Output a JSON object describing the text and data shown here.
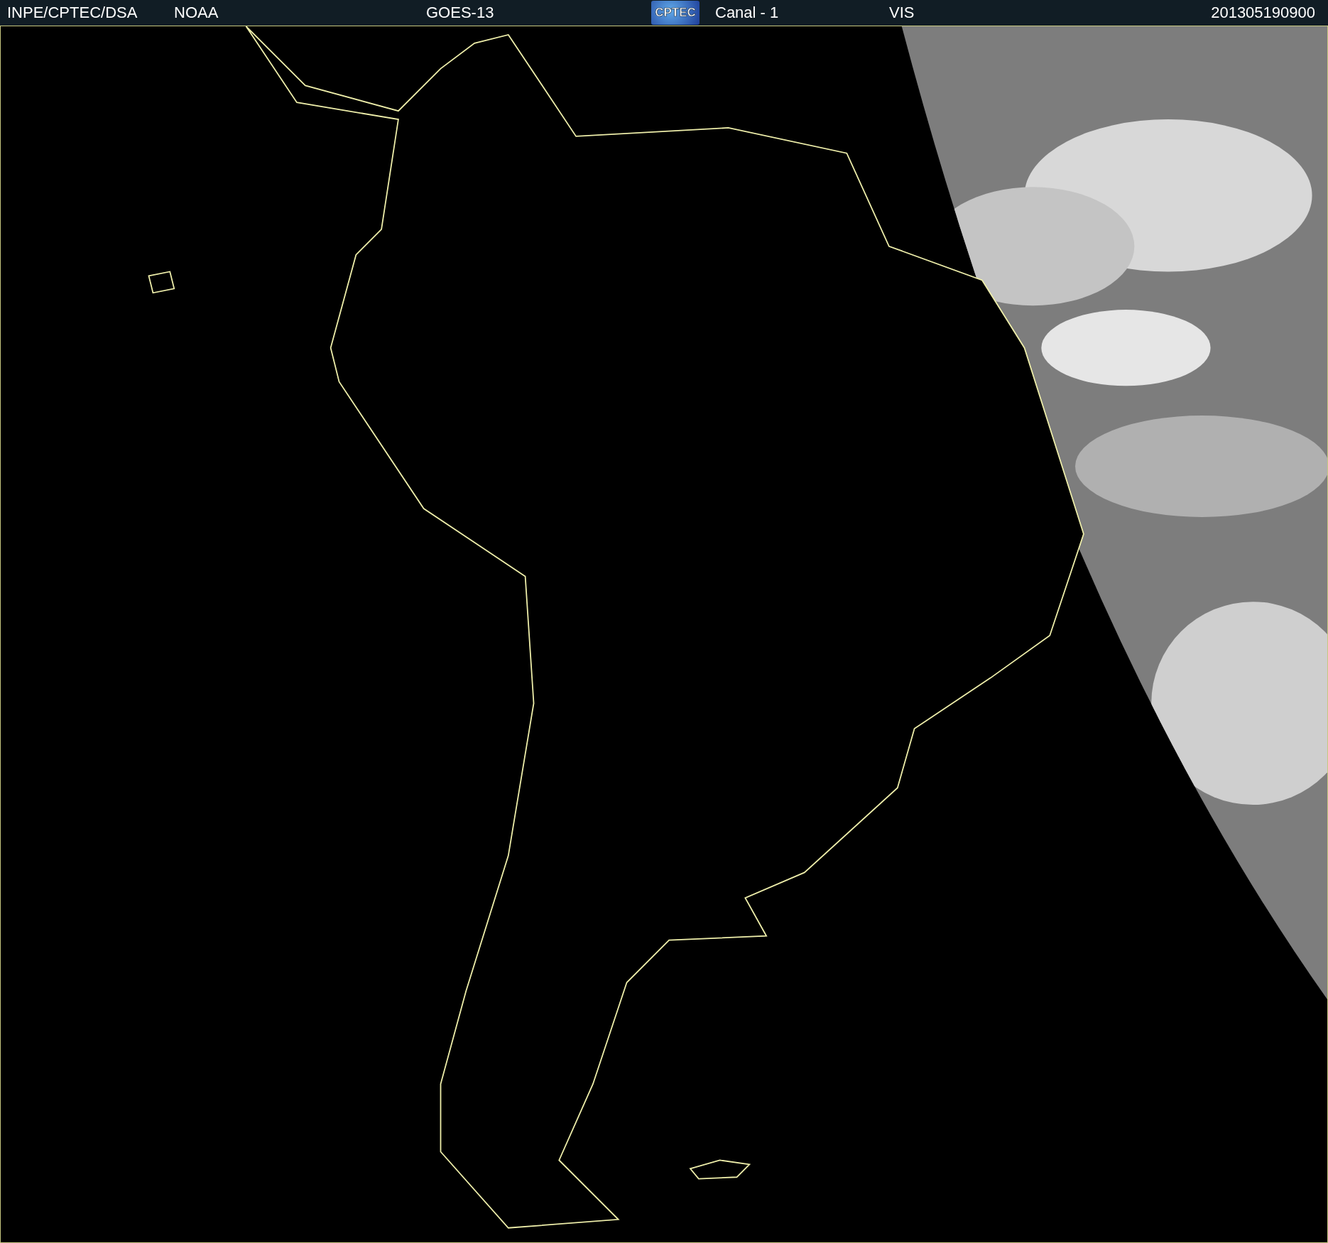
{
  "header": {
    "items": [
      {
        "kind": "text",
        "label": "INPE/CPTEC/DSA"
      },
      {
        "kind": "text",
        "label": "NOAA"
      },
      {
        "kind": "text",
        "label": "GOES-13"
      },
      {
        "kind": "logo",
        "label": "CPTEC"
      },
      {
        "kind": "text",
        "label": "Canal - 1"
      },
      {
        "kind": "text",
        "label": "VIS"
      },
      {
        "kind": "text",
        "label": "201305190900"
      }
    ]
  }
}
